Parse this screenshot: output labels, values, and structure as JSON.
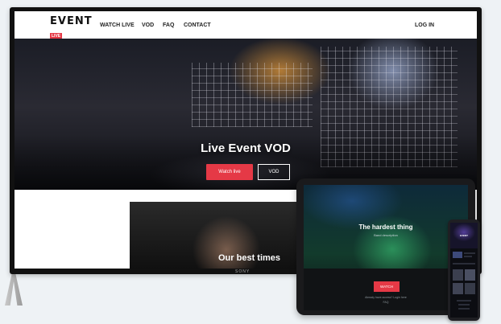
{
  "tv": {
    "brand": "SONY",
    "logo": {
      "main": "EVENT",
      "sub": "LIVE"
    },
    "nav": {
      "items": [
        {
          "label": "WATCH LIVE"
        },
        {
          "label": "VOD"
        },
        {
          "label": "FAQ"
        },
        {
          "label": "CONTACT"
        }
      ],
      "login": "LOG IN"
    },
    "hero": {
      "title": "Live Event VOD",
      "primary_button": "Watch live",
      "secondary_button": "VOD"
    },
    "card": {
      "title": "Our best times"
    }
  },
  "tablet": {
    "title": "The hardest thing",
    "subtitle": "Band description",
    "button": "WATCH",
    "footer_line1": "Already have access? Login here",
    "footer_line2": "FAQ"
  },
  "phone": {
    "hero_label": "EVENT"
  },
  "colors": {
    "accent": "#e53946",
    "background": "#eef2f5"
  }
}
